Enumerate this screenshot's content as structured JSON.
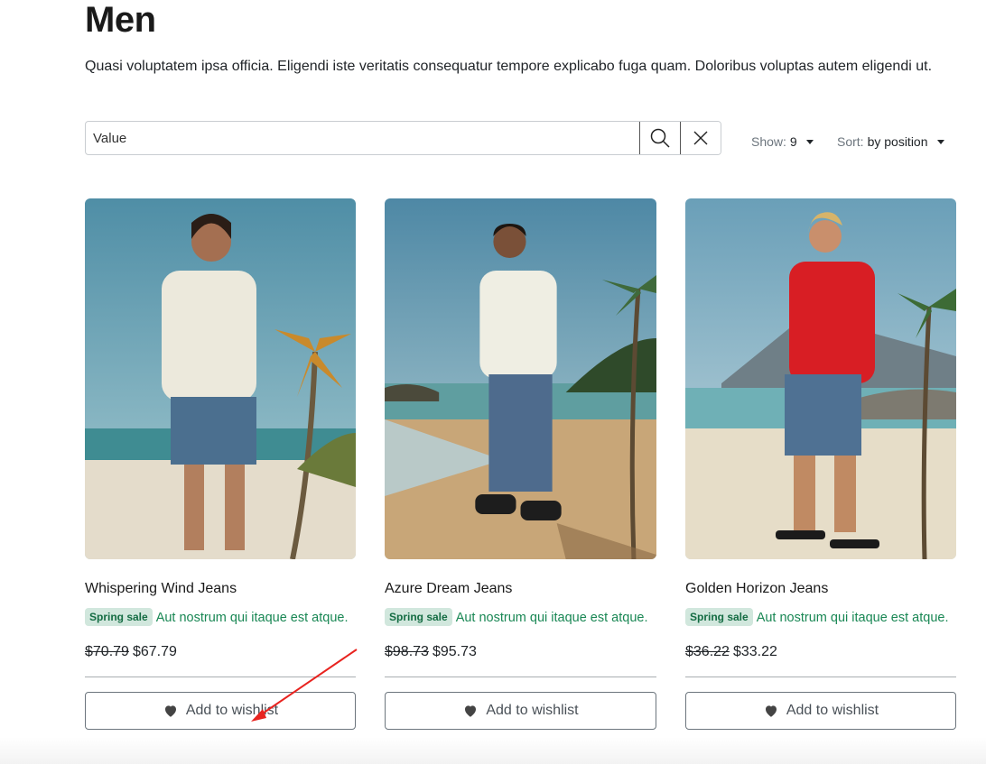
{
  "page": {
    "title": "Men",
    "description": "Quasi voluptatem ipsa officia. Eligendi iste veritatis consequatur tempore explicabo fuga quam. Doloribus voluptas autem eligendi ut."
  },
  "toolbar": {
    "search_value": "Value",
    "show_label": "Show:",
    "show_value": "9",
    "sort_label": "Sort:",
    "sort_value": "by position"
  },
  "products": [
    {
      "name": "Whispering Wind Jeans",
      "badge": "Spring sale",
      "promo_text": "Aut nostrum qui itaque est atque.",
      "old_price": "$70.79",
      "price": "$67.79",
      "wishlist_label": "Add to wishlist"
    },
    {
      "name": "Azure Dream Jeans",
      "badge": "Spring sale",
      "promo_text": "Aut nostrum qui itaque est atque.",
      "old_price": "$98.73",
      "price": "$95.73",
      "wishlist_label": "Add to wishlist"
    },
    {
      "name": "Golden Horizon Jeans",
      "badge": "Spring sale",
      "promo_text": "Aut nostrum qui itaque est atque.",
      "old_price": "$36.22",
      "price": "$33.22",
      "wishlist_label": "Add to wishlist"
    }
  ],
  "icons": {
    "search": "search-icon",
    "clear": "close-icon",
    "wishlist": "heart-icon",
    "show_caret": "caret-down-icon",
    "sort_caret": "caret-down-icon"
  },
  "colors": {
    "sale_badge_bg": "#d1e7dd",
    "sale_text": "#198754",
    "annotation_arrow": "#e8231f"
  }
}
